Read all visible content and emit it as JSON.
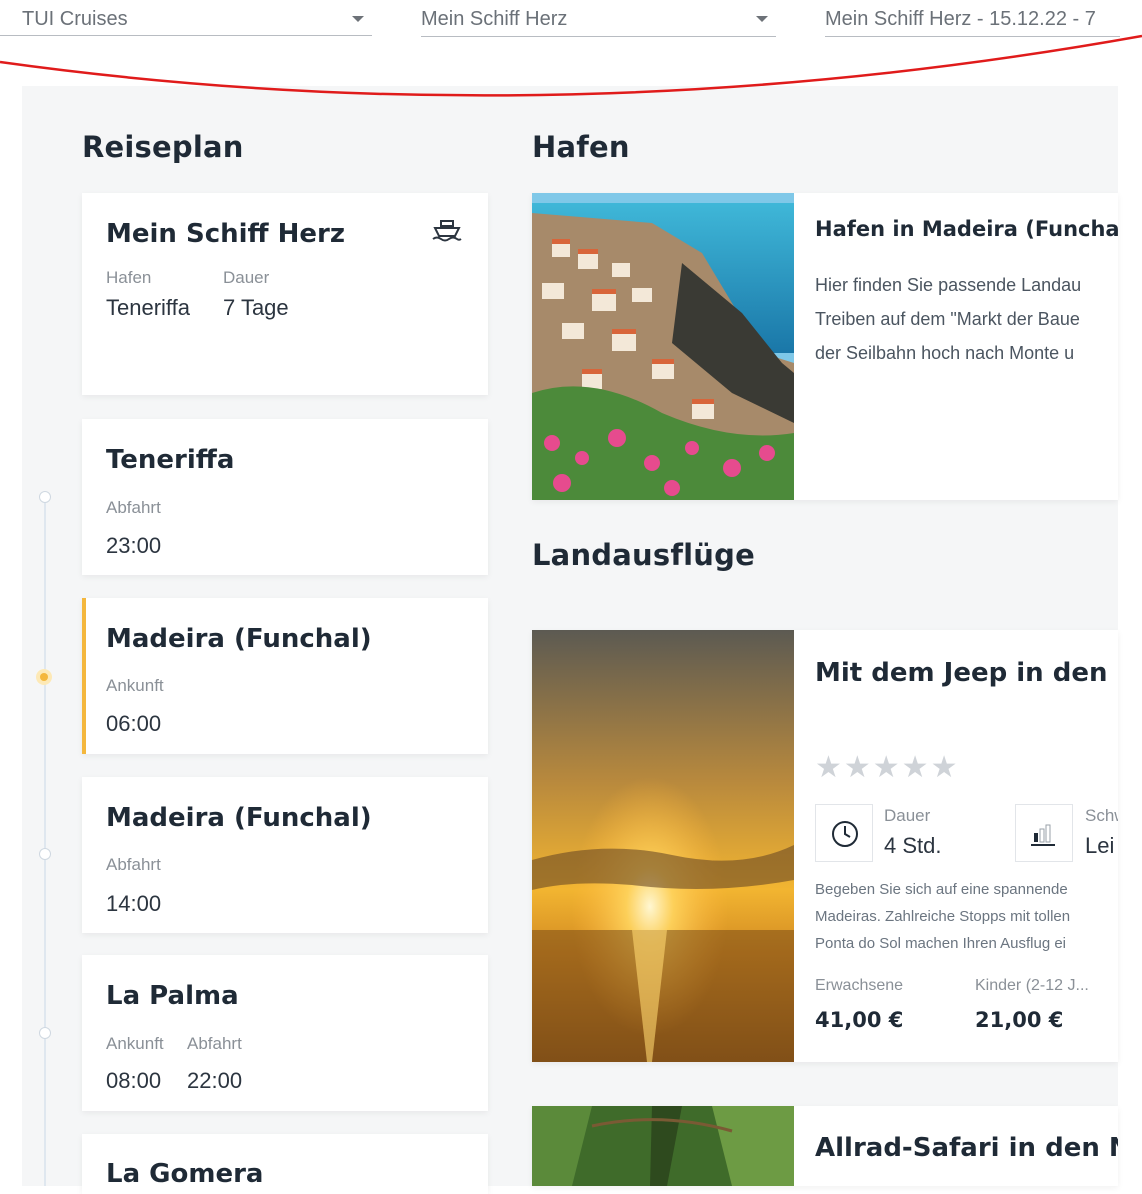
{
  "filters": {
    "provider": "TUI Cruises",
    "ship": "Mein Schiff Herz",
    "trip": "Mein Schiff Herz - 15.12.22 - 7"
  },
  "itinerary": {
    "title": "Reiseplan",
    "overview": {
      "ship_name": "Mein Schiff Herz",
      "port_label": "Hafen",
      "port_value": "Teneriffa",
      "duration_label": "Dauer",
      "duration_value": "7 Tage",
      "icon": "ship-icon"
    },
    "stops": [
      {
        "name": "Teneriffa",
        "labels": [
          "Abfahrt"
        ],
        "values": [
          "23:00"
        ]
      },
      {
        "name": "Madeira (Funchal)",
        "labels": [
          "Ankunft"
        ],
        "values": [
          "06:00"
        ],
        "active": true
      },
      {
        "name": "Madeira (Funchal)",
        "labels": [
          "Abfahrt"
        ],
        "values": [
          "14:00"
        ]
      },
      {
        "name": "La Palma",
        "labels": [
          "Ankunft",
          "Abfahrt"
        ],
        "values": [
          "08:00",
          "22:00"
        ]
      },
      {
        "name": "La Gomera"
      }
    ]
  },
  "port": {
    "title": "Hafen",
    "card_title": "Hafen in Madeira (Funchal)",
    "lines": [
      "Hier finden Sie passende Landau",
      "Treiben auf dem \"Markt der Baue",
      "der Seilbahn hoch nach Monte u"
    ]
  },
  "excursions": {
    "title": "Landausflüge",
    "items": [
      {
        "title": "Mit dem Jeep in den Sc",
        "rating": "★★★★★",
        "duration_label": "Dauer",
        "duration_value": "4 Std.",
        "difficulty_label": "Schw",
        "difficulty_value": "Lei",
        "desc": [
          "Begeben Sie sich auf eine spannende",
          "Madeiras. Zahlreiche Stopps mit tollen",
          "Ponta do Sol machen Ihren Ausflug ei"
        ],
        "adult_label": "Erwachsene",
        "adult_price": "41,00 €",
        "child_label": "Kinder (2-12 J...",
        "child_price": "21,00 €"
      },
      {
        "title": "Allrad-Safari in den N"
      }
    ]
  }
}
